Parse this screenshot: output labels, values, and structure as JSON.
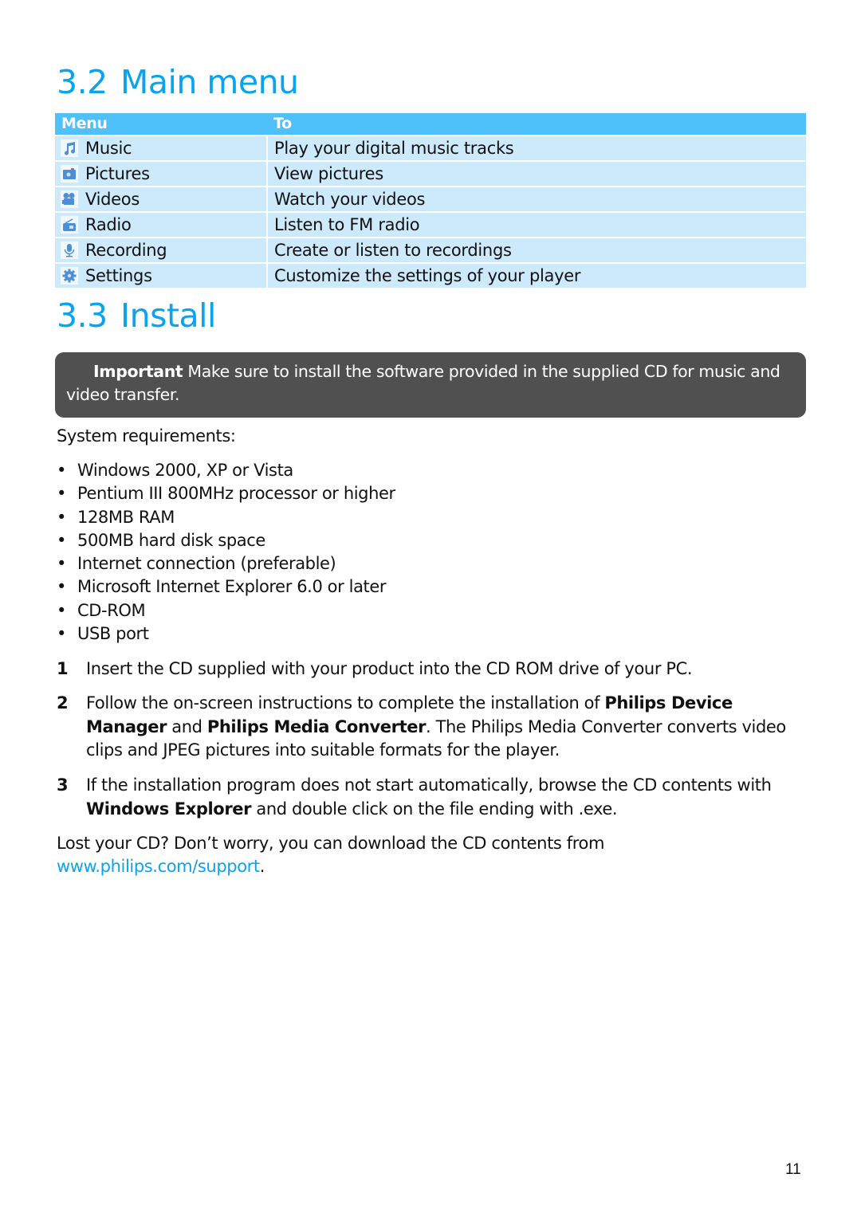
{
  "section_main": {
    "number": "3.2",
    "title": "Main menu"
  },
  "menu_table": {
    "headers": [
      "Menu",
      "To"
    ],
    "rows": [
      {
        "icon": "music-note-icon",
        "menu": "Music",
        "to": "Play your digital music tracks"
      },
      {
        "icon": "camera-icon",
        "menu": "Pictures",
        "to": "View pictures"
      },
      {
        "icon": "video-camera-icon",
        "menu": "Videos",
        "to": "Watch your videos"
      },
      {
        "icon": "radio-icon",
        "menu": "Radio",
        "to": "Listen to FM radio"
      },
      {
        "icon": "microphone-icon",
        "menu": "Recording",
        "to": "Create or listen to recordings"
      },
      {
        "icon": "gear-icon",
        "menu": "Settings",
        "to": "Customize the settings of your player"
      }
    ]
  },
  "section_install": {
    "number": "3.3",
    "title": "Install"
  },
  "important": {
    "label": "Important",
    "text": " Make sure to install the software provided in the supplied CD for music and video transfer."
  },
  "system_requirements": {
    "intro": "System requirements:",
    "items": [
      "Windows 2000, XP or Vista",
      "Pentium III 800MHz processor or higher",
      "128MB RAM",
      "500MB hard disk space",
      "Internet connection (preferable)",
      "Microsoft Internet Explorer 6.0 or later",
      "CD-ROM",
      "USB port"
    ]
  },
  "steps": [
    {
      "number": "1",
      "text": "Insert the CD supplied with your product into the CD ROM drive of your PC."
    },
    {
      "number": "2",
      "parts": [
        "Follow the on-screen instructions to complete the installation of ",
        "Philips Device Manager",
        " and ",
        "Philips Media Converter",
        ". The Philips Media Converter converts video clips and JPEG pictures into suitable formats for the player."
      ]
    },
    {
      "number": "3",
      "parts": [
        "If the installation program does not start automatically, browse the CD contents with ",
        "Windows Explorer",
        " and double click on the file ending with .exe."
      ]
    }
  ],
  "lost_cd": {
    "text": "Lost your CD? Don’t worry, you can download the CD contents from ",
    "link": "www.philips.com/support",
    "after": "."
  },
  "page_number": "11",
  "colors": {
    "heading": "#0aa3f0",
    "table_header": "#4fc1fa",
    "table_row": "#cdeafc",
    "important_bg": "#505050",
    "link": "#0aa3f0"
  }
}
